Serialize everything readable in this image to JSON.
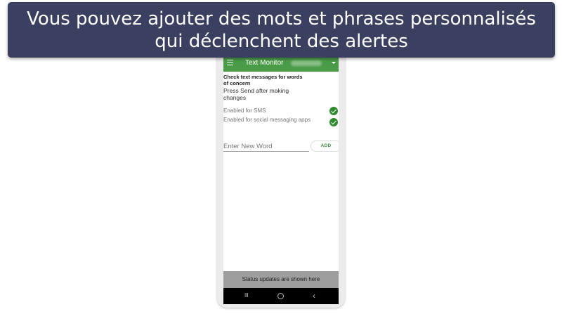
{
  "caption": {
    "line1": "Vous pouvez ajouter des mots et phrases personnalisés",
    "line2": "qui déclenchent des alertes"
  },
  "app": {
    "title": "Text Monitor",
    "heading": "Check text messages for words of concern",
    "instruction": "Press Send after making changes",
    "settings": [
      {
        "label": "Enabled for SMS",
        "enabled": true
      },
      {
        "label": "Enabled for social messaging apps",
        "enabled": true
      }
    ],
    "new_word": {
      "value": "",
      "placeholder": "Enter New Word"
    },
    "add_label": "ADD",
    "status_text": "Status updates are shown here",
    "nav": {
      "recents_glyph": "III",
      "back_glyph": "‹"
    }
  },
  "colors": {
    "banner_bg": "#3b4060",
    "appbar_green": "#4a9b47",
    "check_green": "#2e8b2e",
    "status_bar_gray": "#9e9e9e"
  },
  "icons": [
    "menu-icon",
    "dropdown-arrow-icon",
    "check-icon",
    "recents-icon",
    "home-icon",
    "back-icon"
  ]
}
